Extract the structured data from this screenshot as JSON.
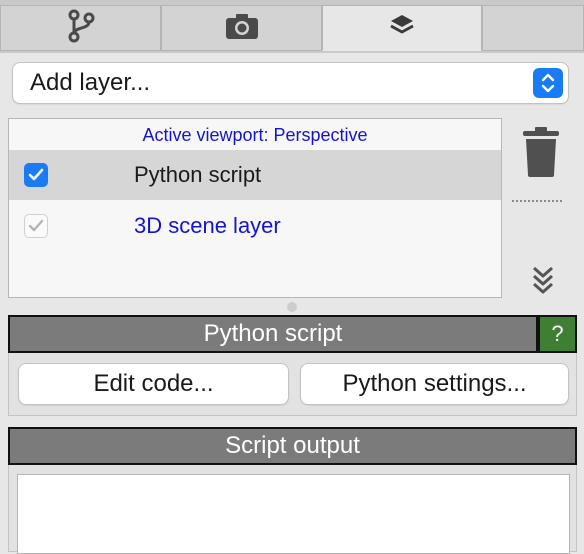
{
  "tabs": [
    {
      "icon": "pipeline-branch-icon"
    },
    {
      "icon": "camera-icon"
    },
    {
      "icon": "layers-icon",
      "active": true
    },
    {
      "icon": ""
    }
  ],
  "add_layer": {
    "label": "Add layer..."
  },
  "layer_list": {
    "viewport_label": "Active viewport: Perspective",
    "layers": [
      {
        "label": "Python script",
        "checked": true,
        "selected": true
      },
      {
        "label": "3D scene layer",
        "checked": true,
        "disabled": true
      }
    ]
  },
  "python_panel": {
    "title": "Python script",
    "help": "?",
    "edit_code": "Edit code...",
    "settings": "Python settings..."
  },
  "output_panel": {
    "title": "Script output",
    "text": ""
  },
  "colors": {
    "accent": "#1a7cf5",
    "link_blue": "#1414cc",
    "header_gray": "#7b7b7b",
    "help_green": "#3f7f34"
  }
}
